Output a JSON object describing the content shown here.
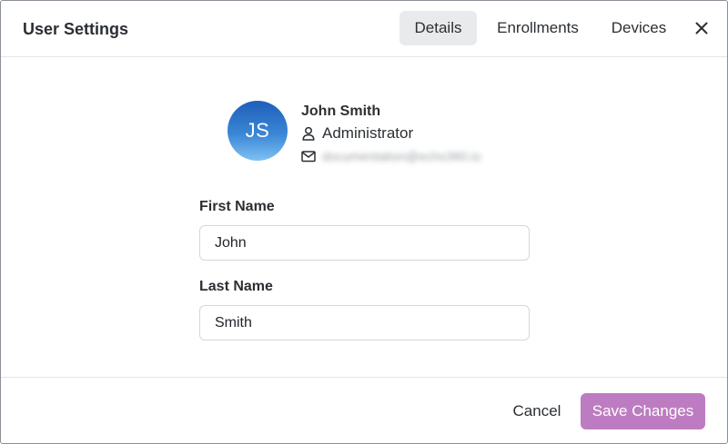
{
  "dialog": {
    "title": "User Settings",
    "tabs": [
      {
        "label": "Details",
        "active": true
      },
      {
        "label": "Enrollments",
        "active": false
      },
      {
        "label": "Devices",
        "active": false
      }
    ],
    "close_icon": "close-icon"
  },
  "user": {
    "initials": "JS",
    "name": "John Smith",
    "role": "Administrator",
    "role_icon": "user-icon",
    "email_icon": "envelope-icon",
    "email_masked": "documentation@echo360.io"
  },
  "form": {
    "first_name": {
      "label": "First Name",
      "value": "John"
    },
    "last_name": {
      "label": "Last Name",
      "value": "Smith"
    }
  },
  "footer": {
    "cancel_label": "Cancel",
    "save_label": "Save Changes"
  },
  "colors": {
    "accent": "#bd7cc1",
    "avatar_top": "#1f5fb8",
    "avatar_bottom": "#7ec1f3",
    "active_tab_bg": "#e9eaec"
  }
}
